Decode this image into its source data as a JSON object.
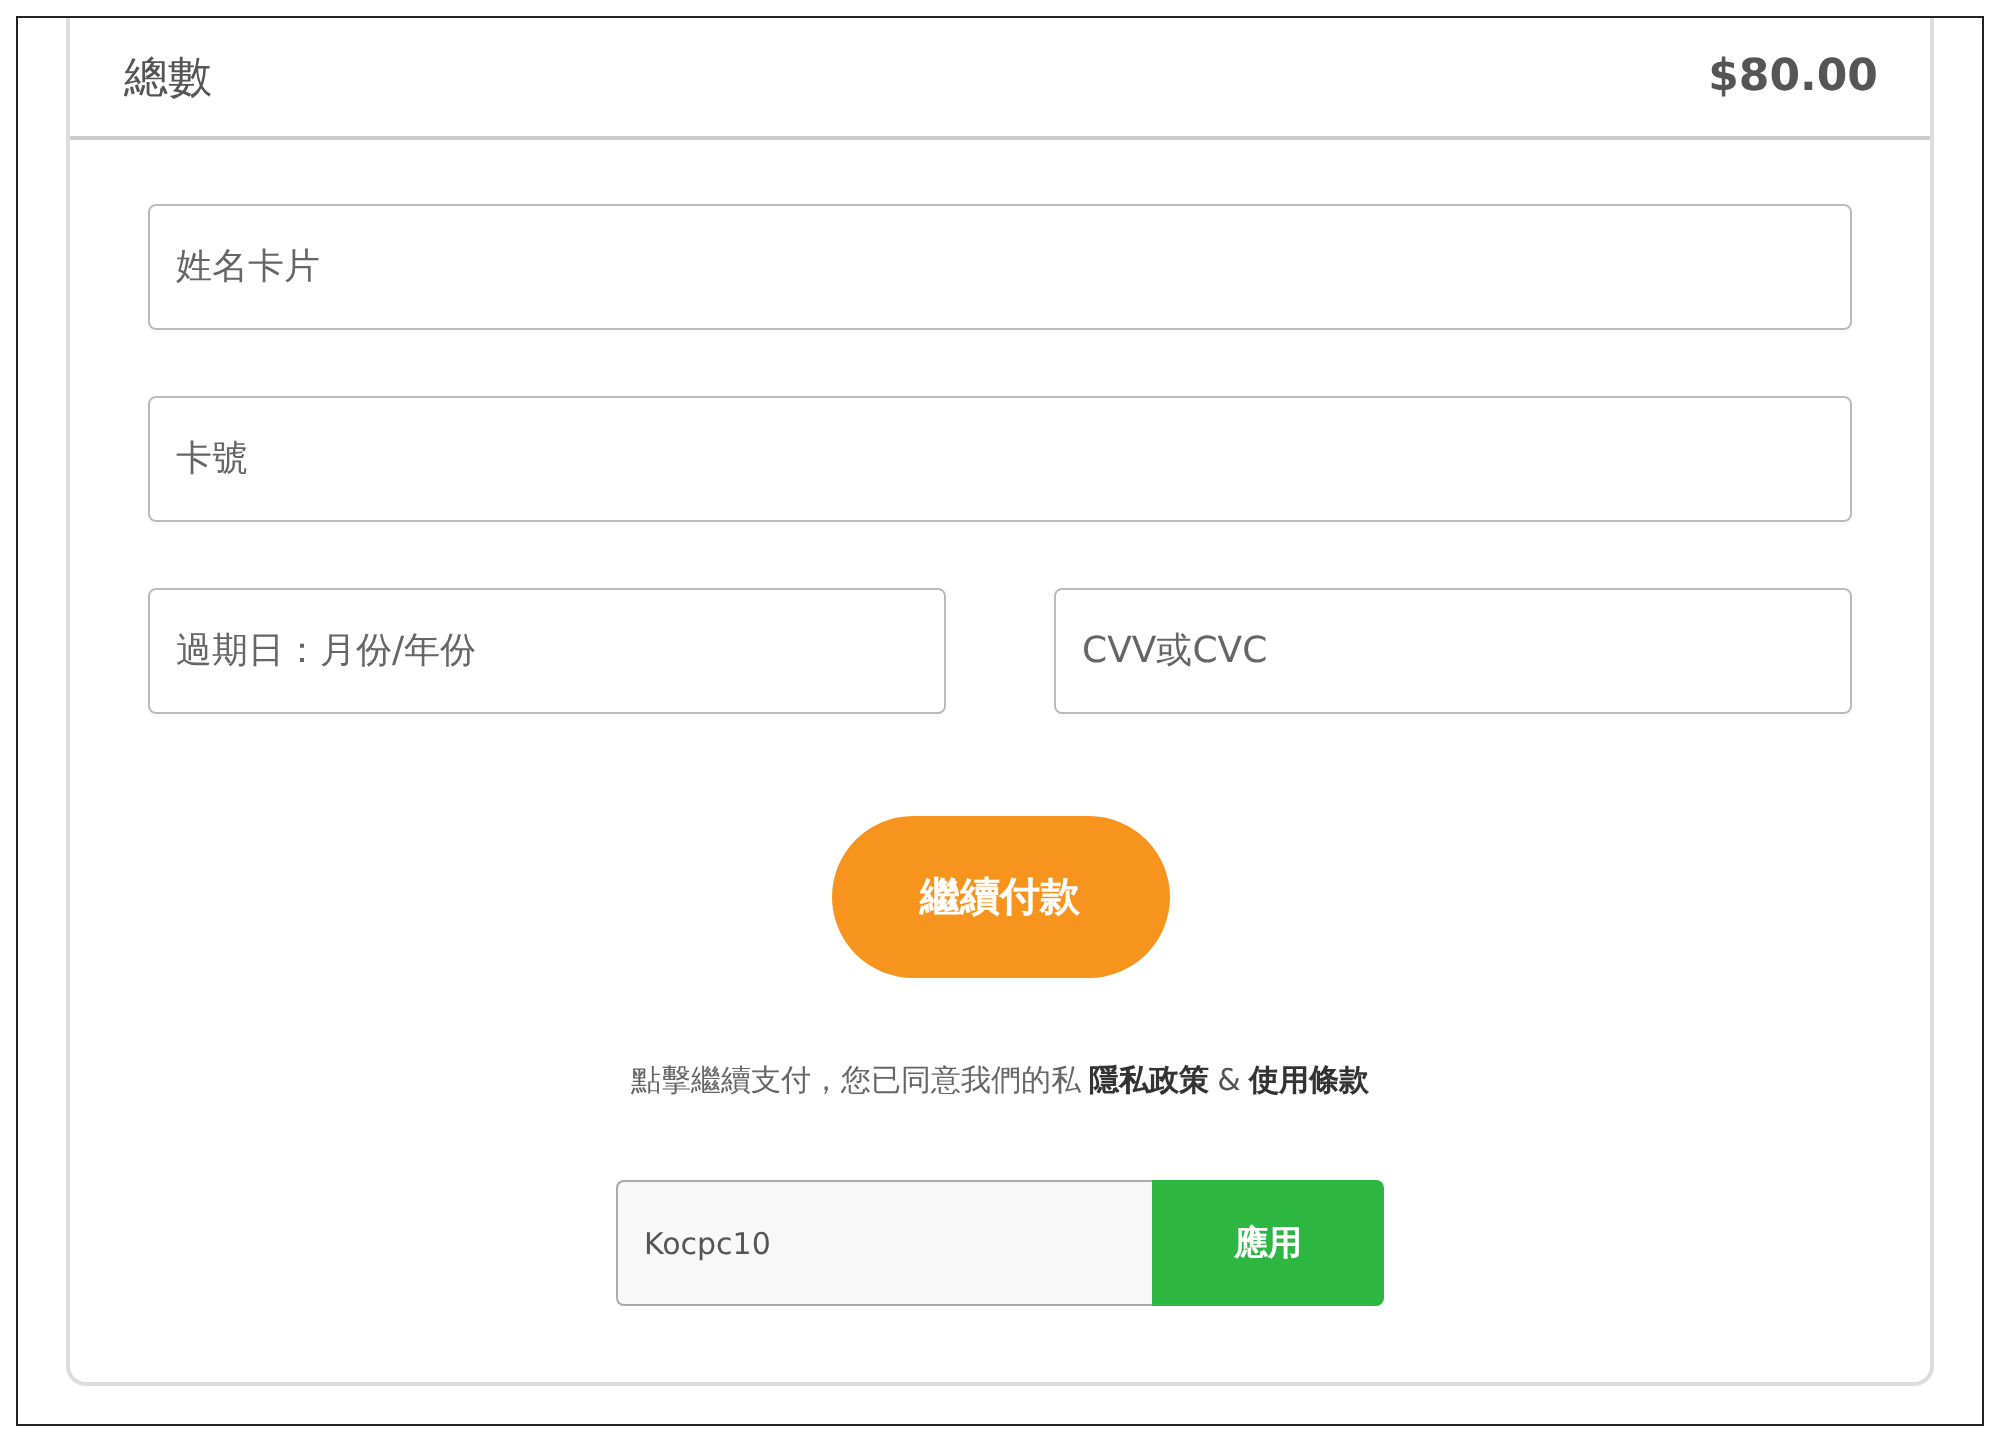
{
  "summary": {
    "label": "總數",
    "amount": "$80.00"
  },
  "fields": [
    {
      "placeholder": "姓名卡片",
      "kind": "wide"
    },
    {
      "placeholder": "卡號",
      "kind": "wide"
    },
    {
      "placeholder": "過期日：月份/年份",
      "kind": "narrow"
    },
    {
      "placeholder": "CVV或CVC",
      "kind": "narrow"
    }
  ],
  "pay_button": "繼續付款",
  "consent": {
    "text": "點擊繼續支付，您已同意我們的私",
    "privacy_link": "隱私政策",
    "separator": "&",
    "terms_link": "使用條款"
  },
  "coupon": {
    "value": "Kocpc10",
    "button": "應用"
  }
}
